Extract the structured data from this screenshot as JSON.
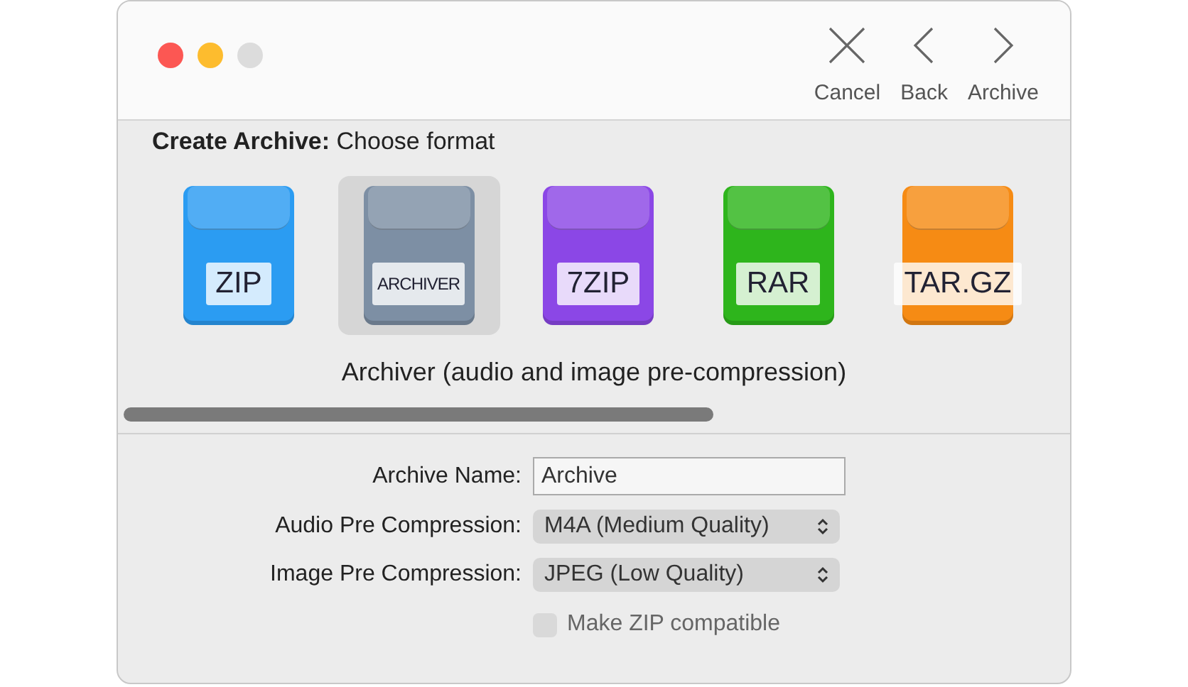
{
  "toolbar": [
    {
      "kind": "cancel",
      "label": "Cancel"
    },
    {
      "kind": "back",
      "label": "Back"
    },
    {
      "kind": "forward",
      "label": "Archive"
    }
  ],
  "heading": {
    "bold": "Create Archive:",
    "text": "Choose format"
  },
  "formats": [
    {
      "label": "ZIP",
      "color": "#2b9cf2",
      "selected": false
    },
    {
      "label": "ARCHIVER",
      "color": "#7d8fa4",
      "selected": true
    },
    {
      "label": "7ZIP",
      "color": "#8b47e6",
      "selected": false
    },
    {
      "label": "RAR",
      "color": "#2eb51c",
      "selected": false
    },
    {
      "label": "TAR.GZ",
      "color": "#f68b14",
      "selected": false
    }
  ],
  "description": "Archiver (audio and image pre-compression)",
  "form": [
    {
      "kind": "text",
      "label": "Archive Name:",
      "value": "Archive"
    },
    {
      "kind": "select",
      "label": "Audio Pre Compression:",
      "value": "M4A (Medium Quality)"
    },
    {
      "kind": "select",
      "label": "Image Pre Compression:",
      "value": "JPEG (Low Quality)"
    }
  ],
  "checkbox": {
    "label": "Make ZIP compatible",
    "checked": false,
    "disabled": true
  }
}
